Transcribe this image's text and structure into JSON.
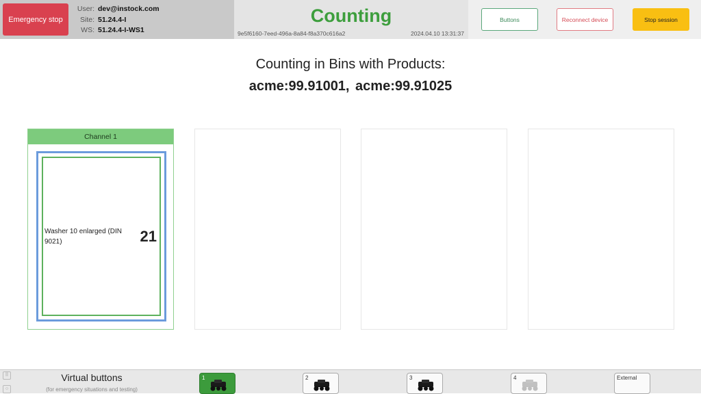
{
  "header": {
    "emergency_stop": "Emergency stop",
    "user_label": "User:",
    "user_value": "dev@instock.com",
    "site_label": "Site:",
    "site_value": "51.24.4-I",
    "ws_label": "WS:",
    "ws_value": "51.24.4-I-WS1",
    "status": "Counting",
    "session_id": "9e5f6160-7eed-496a-8a84-f8a370c616a2",
    "timestamp": "2024.04.10 13:31:37",
    "buttons_label": "Buttons",
    "reconnect_label": "Reconnect device",
    "stop_session_label": "Stop session",
    "colors": {
      "status": "#3d9e3d",
      "emergency": "#d9414f",
      "stop": "#f9bf12"
    }
  },
  "main": {
    "heading": "Counting in Bins with Products:",
    "products": "acme:99.91001,  acme:99.91025"
  },
  "channels": [
    {
      "label": "Channel 1",
      "product": "Washer 10 enlarged (DIN 9021)",
      "count": "21",
      "active": true
    },
    {
      "active": false
    },
    {
      "active": false
    },
    {
      "active": false
    }
  ],
  "footer": {
    "title": "Virtual buttons",
    "subtitle": "(for emergency situations and testing)",
    "buttons": [
      {
        "number": "1",
        "icon": "robot-icon",
        "state": "active"
      },
      {
        "number": "2",
        "icon": "robot-icon",
        "state": "normal"
      },
      {
        "number": "3",
        "icon": "robot-icon",
        "state": "normal"
      },
      {
        "number": "4",
        "icon": "robot-icon",
        "state": "disabled"
      }
    ],
    "external_label": "External"
  }
}
